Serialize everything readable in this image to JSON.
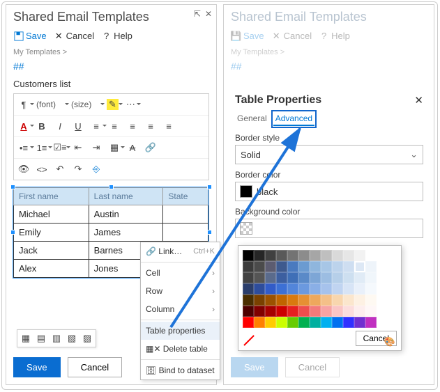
{
  "left": {
    "title": "Shared Email Templates",
    "actions": {
      "save": "Save",
      "cancel": "Cancel",
      "help": "Help"
    },
    "crumb": "My Templates >",
    "hashes": "##",
    "subject": "Customers list",
    "font_label": "(font)",
    "size_label": "(size)",
    "table": {
      "headers": [
        "First name",
        "Last name",
        "State"
      ],
      "rows": [
        [
          "Michael",
          "Austin",
          ""
        ],
        [
          "Emily",
          "James",
          ""
        ],
        [
          "Jack",
          "Barnes",
          ""
        ],
        [
          "Alex",
          "Jones",
          ""
        ]
      ]
    },
    "ctx": {
      "link": "Link…",
      "link_hint": "Ctrl+K",
      "cell": "Cell",
      "row": "Row",
      "column": "Column",
      "props": "Table properties",
      "delete": "Delete table",
      "bind": "Bind to dataset"
    },
    "buttons": {
      "save": "Save",
      "cancel": "Cancel"
    }
  },
  "right": {
    "title": "Shared Email Templates",
    "actions": {
      "save": "Save",
      "cancel": "Cancel",
      "help": "Help"
    },
    "crumb": "My Templates >",
    "hashes": "##",
    "dialog": {
      "title": "Table Properties",
      "tab_general": "General",
      "tab_advanced": "Advanced",
      "border_style_lbl": "Border style",
      "border_style_val": "Solid",
      "border_color_lbl": "Border color",
      "border_color_val": "black",
      "bg_lbl": "Background color",
      "cancel": "Cancel"
    },
    "buttons": {
      "save": "Save",
      "cancel": "Cancel"
    }
  },
  "palette_colors": [
    "#000000",
    "#262626",
    "#404040",
    "#595959",
    "#737373",
    "#8c8c8c",
    "#a6a6a6",
    "#bfbfbf",
    "#d9d9d9",
    "#e6e6e6",
    "#f2f2f2",
    "#ffffff",
    "#3b3b3b",
    "#4b4b4b",
    "#5c5c70",
    "#3e5a8e",
    "#4a7abf",
    "#6b9bd1",
    "#8fb6dd",
    "#a7c6e6",
    "#bcd3ec",
    "#cedef1",
    "#dde8f5",
    "#eef4fa",
    "#424242",
    "#555555",
    "#5a6b8c",
    "#3c5fa0",
    "#3f6fb7",
    "#5a8ac8",
    "#7da6d6",
    "#9cbde2",
    "#b6cfe9",
    "#cddff0",
    "#e0ebf6",
    "#f0f6fb",
    "#2b3e6b",
    "#2e4d9c",
    "#325cc8",
    "#3c70d5",
    "#5285da",
    "#6b99df",
    "#8aafe6",
    "#a6c2ec",
    "#c0d4f1",
    "#d7e4f6",
    "#e9f0fa",
    "#f5f9fd",
    "#4a2e00",
    "#7a4100",
    "#9c5200",
    "#c06500",
    "#d97a0f",
    "#e69033",
    "#eea85c",
    "#f4c088",
    "#f8d6ae",
    "#fbe6cd",
    "#fdf1e3",
    "#fef9f2",
    "#4d0000",
    "#800000",
    "#a60000",
    "#cc0000",
    "#e62020",
    "#ee4d4d",
    "#f37a7a",
    "#f7a3a3",
    "#fac5c5",
    "#fcdddd",
    "#fdeeee",
    "#fef7f7",
    "#ff0000",
    "#ff8000",
    "#ffcc00",
    "#ccff00",
    "#66cc00",
    "#00b050",
    "#00b0a0",
    "#00b0f0",
    "#0070f0",
    "#3030ff",
    "#7030d0",
    "#c030c0"
  ],
  "selected_swatch_index": 22
}
